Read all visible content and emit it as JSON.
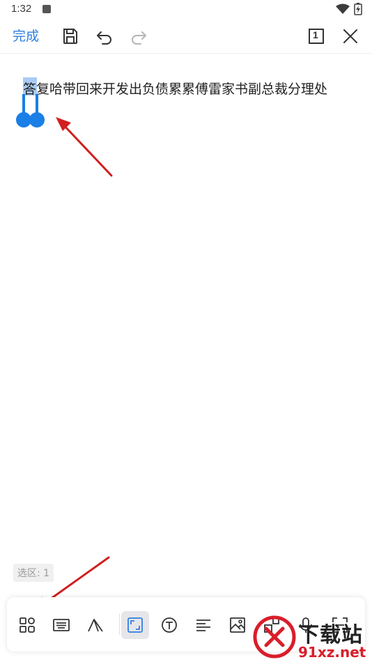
{
  "status_bar": {
    "time": "1:32"
  },
  "toolbar": {
    "done_label": "完成"
  },
  "document": {
    "selected_char": "答",
    "rest_text": "复哈带回来开发出负债累累傅雷家书副总裁分理处"
  },
  "selection": {
    "label": "选区: 1"
  },
  "colors": {
    "accent": "#2f7fe0",
    "selection_handle": "#1a7fe6",
    "arrow": "#d11f1f"
  },
  "icons": {
    "top": [
      "save-icon",
      "undo-icon",
      "redo-icon",
      "page-count-icon",
      "close-icon"
    ],
    "bottom": [
      "apps-icon",
      "keyboard-icon",
      "text-style-icon",
      "select-region-icon",
      "text-box-icon",
      "align-icon",
      "image-icon",
      "shapes-icon",
      "microphone-icon",
      "scan-icon"
    ]
  },
  "page_count_value": "1",
  "watermark": {
    "line1": "下载站",
    "line2": "91xz.net"
  }
}
